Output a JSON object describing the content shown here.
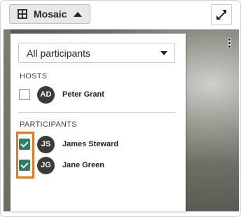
{
  "toolbar": {
    "layout_label": "Mosaic",
    "layout_icon": "grid-icon",
    "expand_icon": "collapse-arrows-icon"
  },
  "panel": {
    "filter_value": "All participants",
    "hosts_title": "HOSTS",
    "participants_title": "PARTICIPANTS",
    "hosts": [
      {
        "initials": "AD",
        "name": "Peter Grant",
        "checked": false
      }
    ],
    "participants": [
      {
        "initials": "JS",
        "name": "James Steward",
        "checked": true
      },
      {
        "initials": "JG",
        "name": "Jane Green",
        "checked": true
      }
    ]
  },
  "colors": {
    "check": "#2e7d60",
    "highlight": "#e87722",
    "avatar": "#3a3a3a"
  }
}
